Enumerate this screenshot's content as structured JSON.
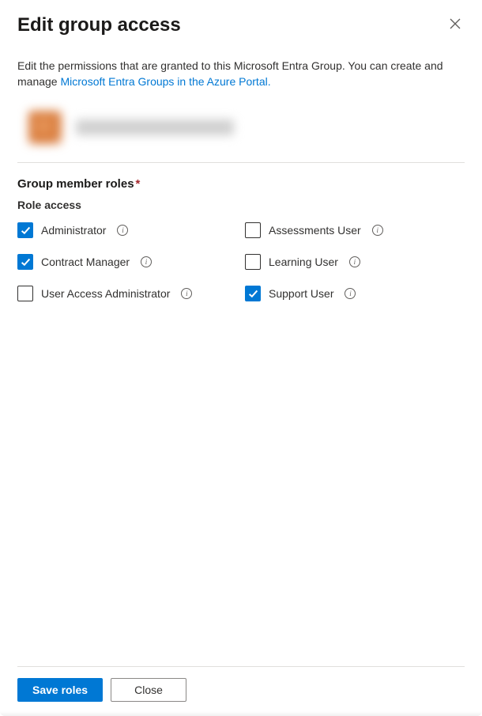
{
  "header": {
    "title": "Edit group access"
  },
  "description": {
    "pre": "Edit the permissions that are granted to this Microsoft Entra Group. You can create and manage ",
    "link": "Microsoft Entra Groups in the Azure Portal.",
    "post": ""
  },
  "section": {
    "label": "Group member roles",
    "sub_label": "Role access"
  },
  "roles": [
    {
      "label": "Administrator",
      "checked": true
    },
    {
      "label": "Assessments User",
      "checked": false
    },
    {
      "label": "Contract Manager",
      "checked": true
    },
    {
      "label": "Learning User",
      "checked": false
    },
    {
      "label": "User Access Administrator",
      "checked": false
    },
    {
      "label": "Support User",
      "checked": true
    }
  ],
  "footer": {
    "save_label": "Save roles",
    "close_label": "Close"
  }
}
